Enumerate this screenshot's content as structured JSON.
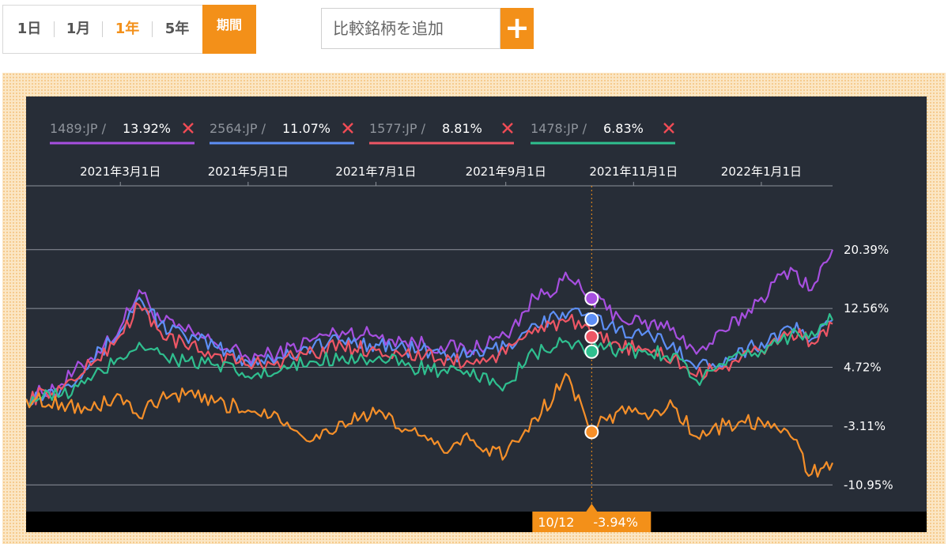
{
  "controls": {
    "ranges": [
      {
        "label": "1日",
        "active": false
      },
      {
        "label": "1月",
        "active": false
      },
      {
        "label": "1年",
        "active": true
      },
      {
        "label": "5年",
        "active": false
      }
    ],
    "period_label": "期間",
    "search_placeholder": "比較銘柄を追加",
    "add_symbol": "+"
  },
  "chart_data": {
    "type": "line",
    "title": "",
    "xlabel": "",
    "ylabel": "",
    "ylim": [
      -14.5,
      25.0
    ],
    "yticks": [
      20.39,
      12.56,
      4.72,
      -3.11,
      -10.95
    ],
    "ytick_labels": [
      "20.39%",
      "12.56%",
      "4.72%",
      "-3.11%",
      "-10.95%"
    ],
    "xlim": [
      "2021-01-15",
      "2022-02-04"
    ],
    "xticks": [
      "2021-03-01",
      "2021-05-01",
      "2021-07-01",
      "2021-09-01",
      "2021-11-01",
      "2022-01-01"
    ],
    "xtick_labels": [
      "2021年3月1日",
      "2021年5月1日",
      "2021年7月1日",
      "2021年9月1日",
      "2021年11月1日",
      "2022年1月1日"
    ],
    "grid": true,
    "legend_position": "top-left",
    "hover": {
      "date": "2021-10-12",
      "date_label": "10/12",
      "value_label": "-3.94%"
    },
    "series": [
      {
        "name": "1489:JP",
        "value_label": "13.92%",
        "color": "#a74fe0",
        "points": [
          [
            "2021-01-15",
            0.5
          ],
          [
            "2021-02-01",
            2.5
          ],
          [
            "2021-02-15",
            6
          ],
          [
            "2021-03-01",
            10
          ],
          [
            "2021-03-10",
            15
          ],
          [
            "2021-03-20",
            11
          ],
          [
            "2021-04-01",
            9.5
          ],
          [
            "2021-04-15",
            8
          ],
          [
            "2021-05-01",
            6
          ],
          [
            "2021-05-15",
            6.5
          ],
          [
            "2021-06-01",
            8.5
          ],
          [
            "2021-06-15",
            9.5
          ],
          [
            "2021-07-01",
            9
          ],
          [
            "2021-07-15",
            8.2
          ],
          [
            "2021-08-01",
            7.5
          ],
          [
            "2021-08-15",
            7
          ],
          [
            "2021-09-01",
            9
          ],
          [
            "2021-09-15",
            14
          ],
          [
            "2021-10-01",
            16.5
          ],
          [
            "2021-10-12",
            13.9
          ],
          [
            "2021-10-25",
            11.5
          ],
          [
            "2021-11-05",
            10.5
          ],
          [
            "2021-11-20",
            10
          ],
          [
            "2021-12-01",
            6.5
          ],
          [
            "2021-12-15",
            9.5
          ],
          [
            "2022-01-01",
            14
          ],
          [
            "2022-01-15",
            18
          ],
          [
            "2022-01-25",
            15
          ],
          [
            "2022-02-04",
            20.4
          ]
        ]
      },
      {
        "name": "2564:JP",
        "value_label": "11.07%",
        "color": "#5d8ff5",
        "points": [
          [
            "2021-01-15",
            0.5
          ],
          [
            "2021-02-01",
            2
          ],
          [
            "2021-02-15",
            5.5
          ],
          [
            "2021-03-01",
            9.5
          ],
          [
            "2021-03-10",
            14
          ],
          [
            "2021-03-20",
            10.5
          ],
          [
            "2021-04-01",
            8.8
          ],
          [
            "2021-04-15",
            7.5
          ],
          [
            "2021-05-01",
            5.5
          ],
          [
            "2021-05-15",
            6
          ],
          [
            "2021-06-01",
            7.5
          ],
          [
            "2021-06-15",
            8.3
          ],
          [
            "2021-07-01",
            7.8
          ],
          [
            "2021-07-15",
            7.2
          ],
          [
            "2021-08-01",
            6.5
          ],
          [
            "2021-08-15",
            6.2
          ],
          [
            "2021-09-01",
            7.5
          ],
          [
            "2021-09-15",
            10.5
          ],
          [
            "2021-10-01",
            12
          ],
          [
            "2021-10-12",
            11.1
          ],
          [
            "2021-10-25",
            10
          ],
          [
            "2021-11-05",
            9
          ],
          [
            "2021-11-20",
            8
          ],
          [
            "2021-12-01",
            4.5
          ],
          [
            "2021-12-15",
            6
          ],
          [
            "2022-01-01",
            8
          ],
          [
            "2022-01-15",
            10
          ],
          [
            "2022-01-25",
            8.5
          ],
          [
            "2022-02-04",
            11
          ]
        ]
      },
      {
        "name": "1577:JP",
        "value_label": "8.81%",
        "color": "#ee5665",
        "points": [
          [
            "2021-01-15",
            0.5
          ],
          [
            "2021-02-01",
            1.8
          ],
          [
            "2021-02-15",
            5
          ],
          [
            "2021-03-01",
            9
          ],
          [
            "2021-03-10",
            13
          ],
          [
            "2021-03-20",
            9.5
          ],
          [
            "2021-04-01",
            7.5
          ],
          [
            "2021-04-15",
            6.5
          ],
          [
            "2021-05-01",
            5
          ],
          [
            "2021-05-15",
            5.5
          ],
          [
            "2021-06-01",
            6.8
          ],
          [
            "2021-06-15",
            7.5
          ],
          [
            "2021-07-01",
            7
          ],
          [
            "2021-07-15",
            6.5
          ],
          [
            "2021-08-01",
            5.8
          ],
          [
            "2021-08-15",
            5.3
          ],
          [
            "2021-09-01",
            6.5
          ],
          [
            "2021-09-15",
            10
          ],
          [
            "2021-10-01",
            11
          ],
          [
            "2021-10-12",
            8.8
          ],
          [
            "2021-10-25",
            7.8
          ],
          [
            "2021-11-05",
            7
          ],
          [
            "2021-11-20",
            6
          ],
          [
            "2021-12-01",
            3.5
          ],
          [
            "2021-12-15",
            5
          ],
          [
            "2022-01-01",
            7
          ],
          [
            "2022-01-15",
            9.5
          ],
          [
            "2022-01-25",
            8
          ],
          [
            "2022-02-04",
            10.5
          ]
        ]
      },
      {
        "name": "1478:JP",
        "value_label": "6.83%",
        "color": "#2fbf8f",
        "points": [
          [
            "2021-01-15",
            0.5
          ],
          [
            "2021-02-01",
            1
          ],
          [
            "2021-02-15",
            3
          ],
          [
            "2021-03-01",
            6
          ],
          [
            "2021-03-10",
            8
          ],
          [
            "2021-03-20",
            6.5
          ],
          [
            "2021-04-01",
            5.5
          ],
          [
            "2021-04-15",
            5
          ],
          [
            "2021-05-01",
            3.5
          ],
          [
            "2021-05-15",
            4
          ],
          [
            "2021-06-01",
            5.5
          ],
          [
            "2021-06-15",
            6.2
          ],
          [
            "2021-07-01",
            5.8
          ],
          [
            "2021-07-15",
            5
          ],
          [
            "2021-08-01",
            4.2
          ],
          [
            "2021-08-15",
            3.5
          ],
          [
            "2021-09-01",
            2.5
          ],
          [
            "2021-09-15",
            6.5
          ],
          [
            "2021-10-01",
            8
          ],
          [
            "2021-10-12",
            6.8
          ],
          [
            "2021-10-25",
            7.2
          ],
          [
            "2021-11-05",
            6.8
          ],
          [
            "2021-11-20",
            6.5
          ],
          [
            "2021-12-01",
            3
          ],
          [
            "2021-12-15",
            5
          ],
          [
            "2022-01-01",
            7
          ],
          [
            "2022-01-15",
            9
          ],
          [
            "2022-01-25",
            9.5
          ],
          [
            "2022-02-04",
            11
          ]
        ]
      },
      {
        "name": "",
        "value_label": "-3.94%",
        "color": "#f58f29",
        "points": [
          [
            "2021-01-15",
            0.5
          ],
          [
            "2021-02-01",
            0
          ],
          [
            "2021-02-15",
            -1
          ],
          [
            "2021-03-01",
            1
          ],
          [
            "2021-03-10",
            -2
          ],
          [
            "2021-03-20",
            0.5
          ],
          [
            "2021-04-01",
            1
          ],
          [
            "2021-04-15",
            0
          ],
          [
            "2021-05-01",
            -1
          ],
          [
            "2021-05-15",
            -1.5
          ],
          [
            "2021-06-01",
            -5
          ],
          [
            "2021-06-15",
            -2.5
          ],
          [
            "2021-07-01",
            -1.5
          ],
          [
            "2021-07-15",
            -3.5
          ],
          [
            "2021-08-01",
            -6
          ],
          [
            "2021-08-15",
            -5
          ],
          [
            "2021-09-01",
            -7
          ],
          [
            "2021-09-15",
            -2
          ],
          [
            "2021-10-01",
            3.5
          ],
          [
            "2021-10-12",
            -3.9
          ],
          [
            "2021-10-25",
            -1
          ],
          [
            "2021-11-05",
            -1.5
          ],
          [
            "2021-11-20",
            -0.5
          ],
          [
            "2021-12-01",
            -4.5
          ],
          [
            "2021-12-15",
            -3
          ],
          [
            "2022-01-01",
            -2.5
          ],
          [
            "2022-01-15",
            -4.5
          ],
          [
            "2022-01-25",
            -9.5
          ],
          [
            "2022-02-04",
            -8
          ]
        ]
      }
    ]
  }
}
